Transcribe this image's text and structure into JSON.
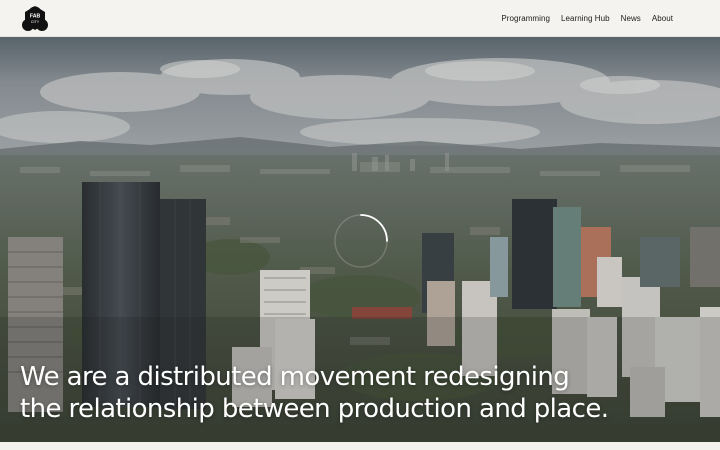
{
  "header": {
    "logo_text": "FAB CITY",
    "nav": [
      {
        "label": "Programming"
      },
      {
        "label": "Learning Hub"
      },
      {
        "label": "News"
      },
      {
        "label": "About"
      }
    ]
  },
  "hero": {
    "headline_line1": "We are a distributed movement redesigning",
    "headline_line2": "the relationship between production and place.",
    "loading": true
  },
  "colors": {
    "header_bg": "#f5f3ef",
    "nav_text": "#1c1c1c",
    "headline": "#ffffff"
  }
}
